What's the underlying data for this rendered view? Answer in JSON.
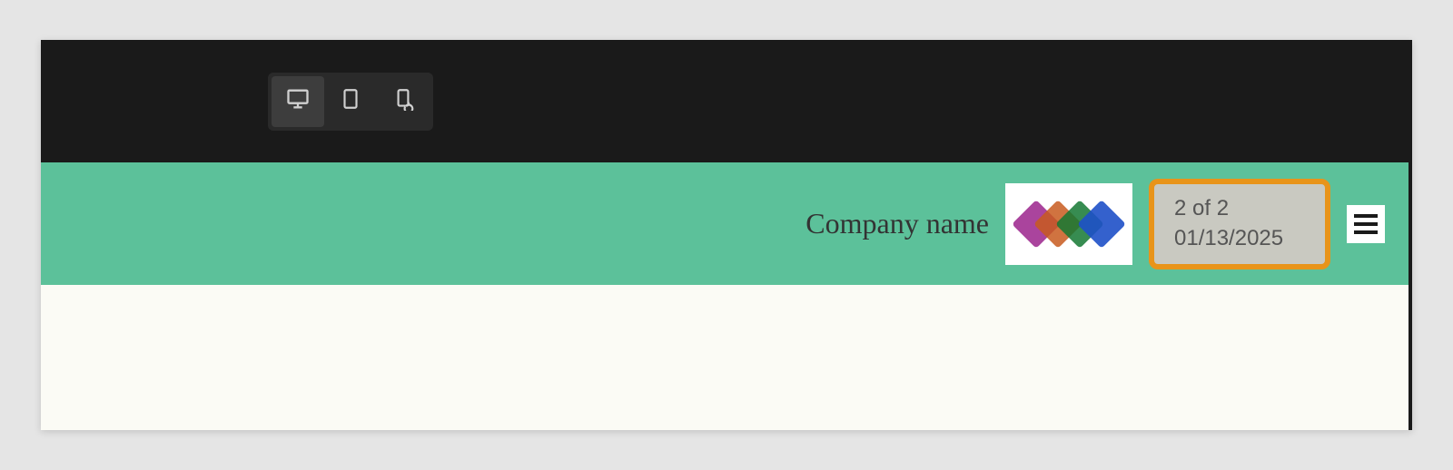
{
  "topbar": {
    "devices": [
      {
        "name": "desktop",
        "active": true
      },
      {
        "name": "tablet",
        "active": false
      },
      {
        "name": "mobile",
        "active": false
      }
    ]
  },
  "header": {
    "company_name": "Company name",
    "logo_colors": [
      "#9b238c",
      "#c85a1e",
      "#147832",
      "#1e50c8"
    ],
    "info": {
      "count_text": "2 of 2",
      "date_text": "01/13/2025"
    },
    "highlight_color": "#e8941a",
    "background_color": "#5cc19a"
  }
}
